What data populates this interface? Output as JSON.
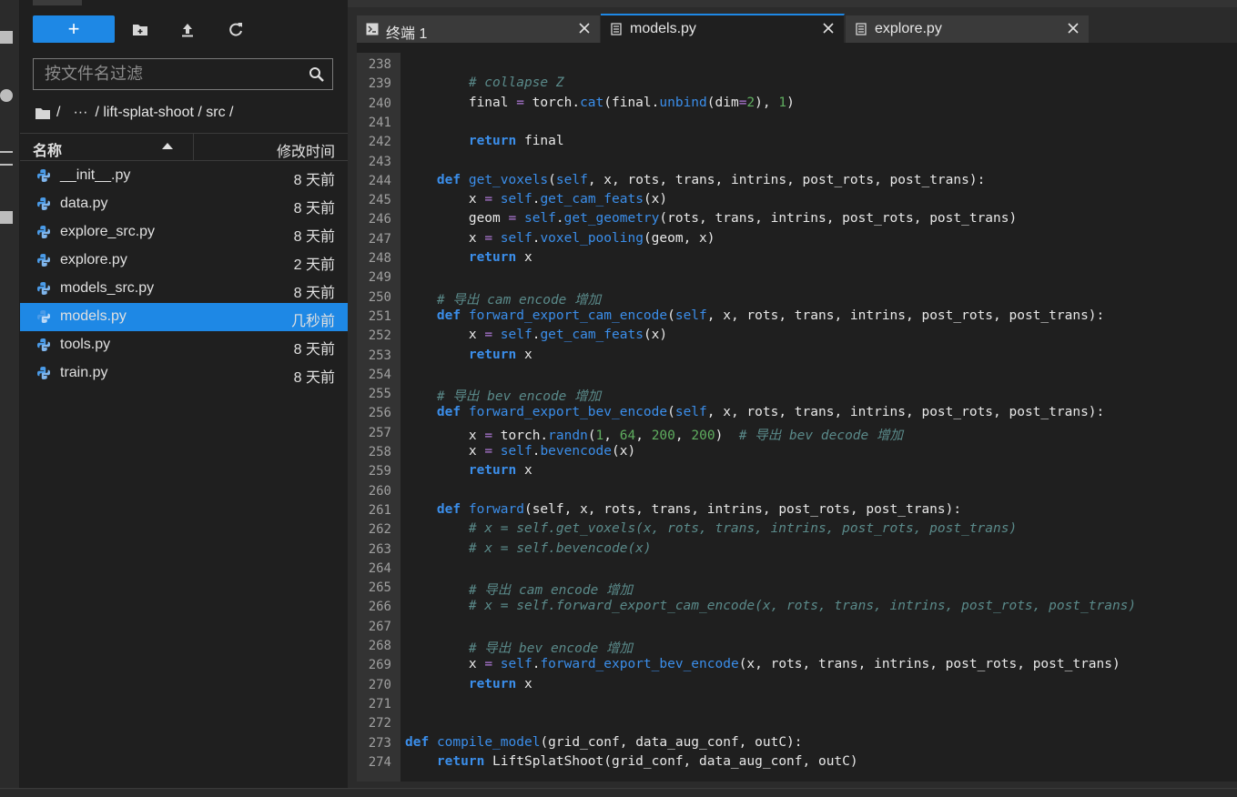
{
  "file_browser": {
    "new_button_label": "+",
    "filter_placeholder": "按文件名过滤",
    "breadcrumb": [
      "/",
      "···",
      "/ lift-splat-shoot / src /"
    ],
    "columns": {
      "name": "名称",
      "modified": "修改时间"
    },
    "files": [
      {
        "name": "__init__.py",
        "modified": "8 天前",
        "selected": false
      },
      {
        "name": "data.py",
        "modified": "8 天前",
        "selected": false
      },
      {
        "name": "explore_src.py",
        "modified": "8 天前",
        "selected": false
      },
      {
        "name": "explore.py",
        "modified": "2 天前",
        "selected": false
      },
      {
        "name": "models_src.py",
        "modified": "8 天前",
        "selected": false
      },
      {
        "name": "models.py",
        "modified": "几秒前",
        "selected": true
      },
      {
        "name": "tools.py",
        "modified": "8 天前",
        "selected": false
      },
      {
        "name": "train.py",
        "modified": "8 天前",
        "selected": false
      }
    ]
  },
  "tabs": [
    {
      "label": "终端 1",
      "icon": "terminal-icon",
      "active": false
    },
    {
      "label": "models.py",
      "icon": "file-icon",
      "active": true
    },
    {
      "label": "explore.py",
      "icon": "file-icon",
      "active": false
    }
  ],
  "editor": {
    "lines": [
      {
        "num": "238",
        "tokens": []
      },
      {
        "num": "239",
        "tokens": [
          [
            "        ",
            ""
          ],
          [
            "# collapse Z",
            "c"
          ]
        ]
      },
      {
        "num": "240",
        "tokens": [
          [
            "        final ",
            ""
          ],
          [
            "=",
            "o"
          ],
          [
            " torch.",
            ""
          ],
          [
            "cat",
            "f"
          ],
          [
            "(final.",
            ""
          ],
          [
            "unbind",
            "f"
          ],
          [
            "(dim",
            ""
          ],
          [
            "=",
            "o"
          ],
          [
            "2",
            "n"
          ],
          [
            "), ",
            ""
          ],
          [
            "1",
            "n"
          ],
          [
            ")",
            ""
          ]
        ]
      },
      {
        "num": "241",
        "tokens": []
      },
      {
        "num": "242",
        "tokens": [
          [
            "        ",
            ""
          ],
          [
            "return",
            "k"
          ],
          [
            " final",
            ""
          ]
        ]
      },
      {
        "num": "243",
        "tokens": []
      },
      {
        "num": "244",
        "tokens": [
          [
            "    ",
            ""
          ],
          [
            "def",
            "k"
          ],
          [
            " ",
            ""
          ],
          [
            "get_voxels",
            "f"
          ],
          [
            "(",
            ""
          ],
          [
            "self",
            "s"
          ],
          [
            ", x, rots, trans, intrins, post_rots, post_trans):",
            ""
          ]
        ]
      },
      {
        "num": "245",
        "tokens": [
          [
            "        x ",
            ""
          ],
          [
            "=",
            "o"
          ],
          [
            " ",
            ""
          ],
          [
            "self",
            "s"
          ],
          [
            ".",
            ""
          ],
          [
            "get_cam_feats",
            "f"
          ],
          [
            "(x)",
            ""
          ]
        ]
      },
      {
        "num": "246",
        "tokens": [
          [
            "        geom ",
            ""
          ],
          [
            "=",
            "o"
          ],
          [
            " ",
            ""
          ],
          [
            "self",
            "s"
          ],
          [
            ".",
            ""
          ],
          [
            "get_geometry",
            "f"
          ],
          [
            "(rots, trans, intrins, post_rots, post_trans)",
            ""
          ]
        ]
      },
      {
        "num": "247",
        "tokens": [
          [
            "        x ",
            ""
          ],
          [
            "=",
            "o"
          ],
          [
            " ",
            ""
          ],
          [
            "self",
            "s"
          ],
          [
            ".",
            ""
          ],
          [
            "voxel_pooling",
            "f"
          ],
          [
            "(geom, x)",
            ""
          ]
        ]
      },
      {
        "num": "248",
        "tokens": [
          [
            "        ",
            ""
          ],
          [
            "return",
            "k"
          ],
          [
            " x",
            ""
          ]
        ]
      },
      {
        "num": "249",
        "tokens": []
      },
      {
        "num": "250",
        "tokens": [
          [
            "    ",
            ""
          ],
          [
            "# 导出 cam encode 增加",
            "c"
          ]
        ]
      },
      {
        "num": "251",
        "tokens": [
          [
            "    ",
            ""
          ],
          [
            "def",
            "k"
          ],
          [
            " ",
            ""
          ],
          [
            "forward_export_cam_encode",
            "f"
          ],
          [
            "(",
            ""
          ],
          [
            "self",
            "s"
          ],
          [
            ", x, rots, trans, intrins, post_rots, post_trans):",
            ""
          ]
        ]
      },
      {
        "num": "252",
        "tokens": [
          [
            "        x ",
            ""
          ],
          [
            "=",
            "o"
          ],
          [
            " ",
            ""
          ],
          [
            "self",
            "s"
          ],
          [
            ".",
            ""
          ],
          [
            "get_cam_feats",
            "f"
          ],
          [
            "(x)",
            ""
          ]
        ]
      },
      {
        "num": "253",
        "tokens": [
          [
            "        ",
            ""
          ],
          [
            "return",
            "k"
          ],
          [
            " x",
            ""
          ]
        ]
      },
      {
        "num": "254",
        "tokens": []
      },
      {
        "num": "255",
        "tokens": [
          [
            "    ",
            ""
          ],
          [
            "# 导出 bev encode 增加",
            "c"
          ]
        ]
      },
      {
        "num": "256",
        "tokens": [
          [
            "    ",
            ""
          ],
          [
            "def",
            "k"
          ],
          [
            " ",
            ""
          ],
          [
            "forward_export_bev_encode",
            "f"
          ],
          [
            "(",
            ""
          ],
          [
            "self",
            "s"
          ],
          [
            ", x, rots, trans, intrins, post_rots, post_trans):",
            ""
          ]
        ]
      },
      {
        "num": "257",
        "tokens": [
          [
            "        x ",
            ""
          ],
          [
            "=",
            "o"
          ],
          [
            " torch.",
            ""
          ],
          [
            "randn",
            "f"
          ],
          [
            "(",
            ""
          ],
          [
            "1",
            "n"
          ],
          [
            ", ",
            ""
          ],
          [
            "64",
            "n"
          ],
          [
            ", ",
            ""
          ],
          [
            "200",
            "n"
          ],
          [
            ", ",
            ""
          ],
          [
            "200",
            "n"
          ],
          [
            ")  ",
            ""
          ],
          [
            "# 导出 bev decode 增加",
            "c"
          ]
        ]
      },
      {
        "num": "258",
        "tokens": [
          [
            "        x ",
            ""
          ],
          [
            "=",
            "o"
          ],
          [
            " ",
            ""
          ],
          [
            "self",
            "s"
          ],
          [
            ".",
            ""
          ],
          [
            "bevencode",
            "f"
          ],
          [
            "(x)",
            ""
          ]
        ]
      },
      {
        "num": "259",
        "tokens": [
          [
            "        ",
            ""
          ],
          [
            "return",
            "k"
          ],
          [
            " x",
            ""
          ]
        ]
      },
      {
        "num": "260",
        "tokens": []
      },
      {
        "num": "261",
        "tokens": [
          [
            "    ",
            ""
          ],
          [
            "def",
            "k"
          ],
          [
            " ",
            ""
          ],
          [
            "forward",
            "f"
          ],
          [
            "(self, x, rots, trans, intrins, post_rots, post_trans):",
            ""
          ]
        ]
      },
      {
        "num": "262",
        "tokens": [
          [
            "        ",
            ""
          ],
          [
            "# x = self.get_voxels(x, rots, trans, intrins, post_rots, post_trans)",
            "c"
          ]
        ]
      },
      {
        "num": "263",
        "tokens": [
          [
            "        ",
            ""
          ],
          [
            "# x = self.bevencode(x)",
            "c"
          ]
        ]
      },
      {
        "num": "264",
        "tokens": []
      },
      {
        "num": "265",
        "tokens": [
          [
            "        ",
            ""
          ],
          [
            "# 导出 cam encode 增加",
            "c"
          ]
        ]
      },
      {
        "num": "266",
        "tokens": [
          [
            "        ",
            ""
          ],
          [
            "# x = self.forward_export_cam_encode(x, rots, trans, intrins, post_rots, post_trans)",
            "c"
          ]
        ]
      },
      {
        "num": "267",
        "tokens": []
      },
      {
        "num": "268",
        "tokens": [
          [
            "        ",
            ""
          ],
          [
            "# 导出 bev encode 增加",
            "c"
          ]
        ]
      },
      {
        "num": "269",
        "tokens": [
          [
            "        x ",
            ""
          ],
          [
            "=",
            "o"
          ],
          [
            " ",
            ""
          ],
          [
            "self",
            "s"
          ],
          [
            ".",
            ""
          ],
          [
            "forward_export_bev_encode",
            "f"
          ],
          [
            "(x, rots, trans, intrins, post_rots, post_trans)",
            ""
          ]
        ]
      },
      {
        "num": "270",
        "tokens": [
          [
            "        ",
            ""
          ],
          [
            "return",
            "k"
          ],
          [
            " x",
            ""
          ]
        ]
      },
      {
        "num": "271",
        "tokens": []
      },
      {
        "num": "272",
        "tokens": []
      },
      {
        "num": "273",
        "tokens": [
          [
            "",
            ""
          ],
          [
            "def",
            "k"
          ],
          [
            " ",
            ""
          ],
          [
            "compile_model",
            "f"
          ],
          [
            "(grid_conf, data_aug_conf, outC):",
            ""
          ]
        ]
      },
      {
        "num": "274",
        "tokens": [
          [
            "    ",
            ""
          ],
          [
            "return",
            "k"
          ],
          [
            " LiftSplatShoot(grid_conf, data_aug_conf, outC)",
            ""
          ]
        ]
      }
    ]
  }
}
